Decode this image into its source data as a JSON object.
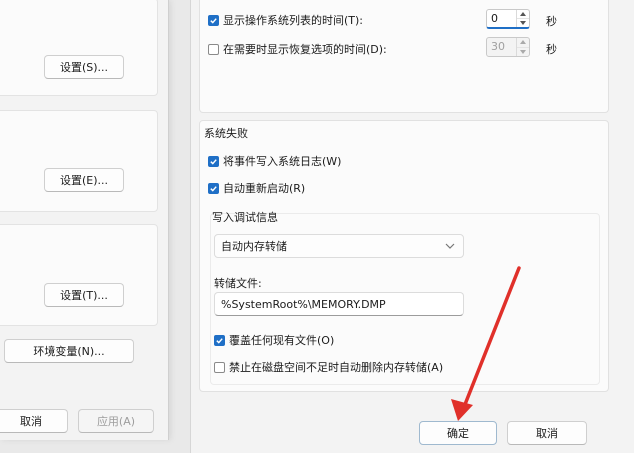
{
  "left_dialog": {
    "settings_s": "设置(S)...",
    "settings_e": "设置(E)...",
    "settings_t": "设置(T)...",
    "env_vars": "环境变量(N)...",
    "cancel": "取消",
    "apply": "应用(A)"
  },
  "right_dialog": {
    "os_list": {
      "show_time_label": "显示操作系统列表的时间(T):",
      "show_time_checked": true,
      "show_time_value": "0",
      "show_time_unit": "秒",
      "recovery_label": "在需要时显示恢复选项的时间(D):",
      "recovery_checked": false,
      "recovery_value": "30",
      "recovery_unit": "秒"
    },
    "system_failure": {
      "title": "系统失败",
      "write_event_label": "将事件写入系统日志(W)",
      "write_event_checked": true,
      "auto_restart_label": "自动重新启动(R)",
      "auto_restart_checked": true
    },
    "debug_info": {
      "title": "写入调试信息",
      "dump_type": "自动内存转储",
      "dump_file_label": "转储文件:",
      "dump_file_value": "%SystemRoot%\\MEMORY.DMP",
      "overwrite_label": "覆盖任何现有文件(O)",
      "overwrite_checked": true,
      "disable_auto_delete_label": "禁止在磁盘空间不足时自动删除内存转储(A)",
      "disable_auto_delete_checked": false
    },
    "ok": "确定",
    "cancel": "取消"
  },
  "annotation": {
    "arrow_color": "#e0302a"
  },
  "colors": {
    "accent": "#1f6fc6"
  }
}
